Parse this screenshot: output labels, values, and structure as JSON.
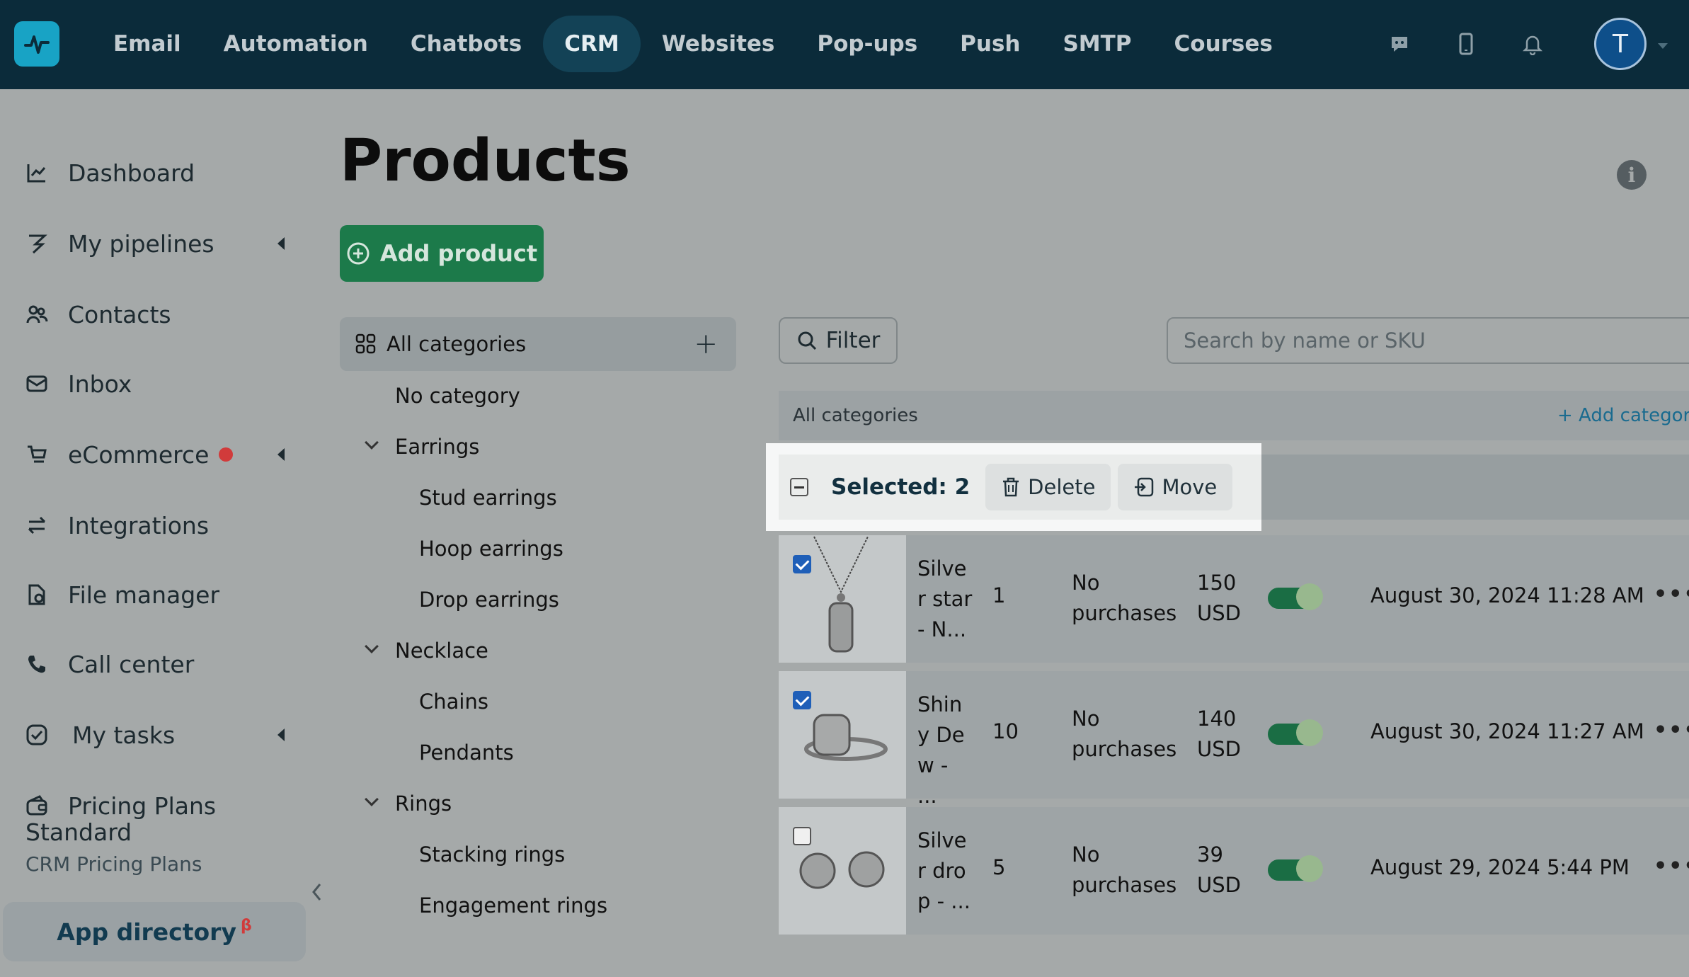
{
  "nav": {
    "items": [
      "Email",
      "Automation",
      "Chatbots",
      "CRM",
      "Websites",
      "Pop-ups",
      "Push",
      "SMTP",
      "Courses"
    ],
    "active": "CRM",
    "avatar_letter": "T"
  },
  "sidebar": {
    "items": [
      {
        "label": "Dashboard",
        "icon": "chart-icon"
      },
      {
        "label": "My pipelines",
        "icon": "pipeline-icon"
      },
      {
        "label": "Contacts",
        "icon": "contacts-icon"
      },
      {
        "label": "Inbox",
        "icon": "inbox-icon"
      },
      {
        "label": "eCommerce",
        "icon": "cart-icon"
      },
      {
        "label": "Integrations",
        "icon": "integrations-icon"
      },
      {
        "label": "File manager",
        "icon": "file-icon"
      },
      {
        "label": "Call center",
        "icon": "phone-icon"
      },
      {
        "label": "My tasks",
        "icon": "tasks-icon"
      },
      {
        "label": "Pricing Plans",
        "icon": "wallet-icon"
      }
    ],
    "plan_name": "Standard",
    "plan_sub": "CRM Pricing Plans",
    "app_directory": "App directory",
    "beta_mark": "β"
  },
  "page": {
    "title": "Products",
    "add_product": "Add product",
    "info": "i"
  },
  "categories": {
    "all": "All categories",
    "no_category": "No category",
    "groups": [
      {
        "name": "Earrings",
        "children": [
          "Stud earrings",
          "Hoop earrings",
          "Drop earrings"
        ]
      },
      {
        "name": "Necklace",
        "children": [
          "Chains",
          "Pendants"
        ]
      },
      {
        "name": "Rings",
        "children": [
          "Stacking rings",
          "Engagement rings"
        ]
      }
    ]
  },
  "toolbar": {
    "filter": "Filter",
    "search_placeholder": "Search by name or SKU",
    "breadcrumb": "All categories",
    "add_category": "+ Add category"
  },
  "selection": {
    "text": "Selected: 2",
    "delete": "Delete",
    "move": "Move"
  },
  "products": [
    {
      "name": "Silver star - N...",
      "qty": "1",
      "purchases": "No purchases",
      "price": "150 USD",
      "date": "August 30, 2024 11:28 AM",
      "checked": true
    },
    {
      "name": "Shiny Dew - ...",
      "qty": "10",
      "purchases": "No purchases",
      "price": "140 USD",
      "date": "August 30, 2024 11:27 AM",
      "checked": true
    },
    {
      "name": "Silver drop - ...",
      "qty": "5",
      "purchases": "No purchases",
      "price": "39 USD",
      "date": "August 29, 2024 5:44 PM",
      "checked": false
    }
  ],
  "more_glyph": "•••",
  "colors": {
    "topbar": "#0b2b3a",
    "accent_green": "#1c7a4a",
    "link": "#1a6b8f",
    "alert_red": "#d13b3b"
  }
}
